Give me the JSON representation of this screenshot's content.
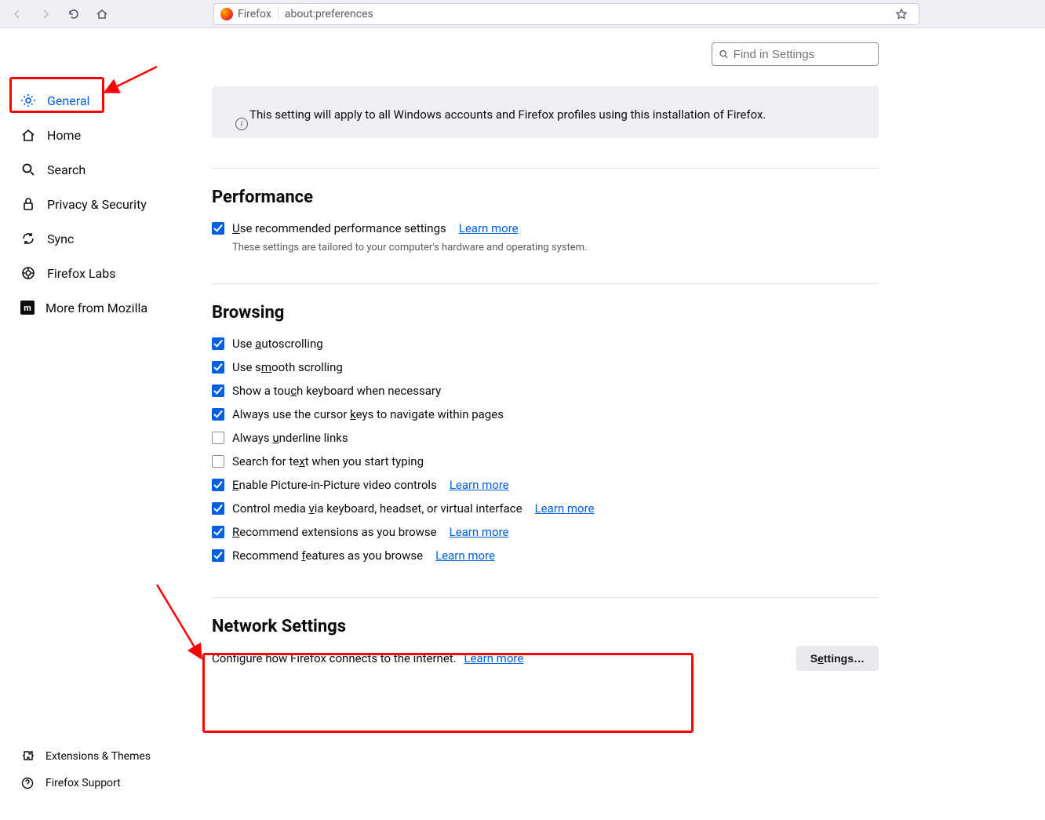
{
  "toolbar": {
    "identity_label": "Firefox",
    "url": "about:preferences"
  },
  "search": {
    "placeholder": "Find in Settings"
  },
  "sidebar": {
    "items": [
      {
        "label": "General"
      },
      {
        "label": "Home"
      },
      {
        "label": "Search"
      },
      {
        "label": "Privacy & Security"
      },
      {
        "label": "Sync"
      },
      {
        "label": "Firefox Labs"
      },
      {
        "label": "More from Mozilla"
      }
    ],
    "bottom": [
      {
        "label": "Extensions & Themes"
      },
      {
        "label": "Firefox Support"
      }
    ]
  },
  "infobox": {
    "text": "This setting will apply to all Windows accounts and Firefox profiles using this installation of Firefox."
  },
  "performance": {
    "title": "Performance",
    "option_pre": "U",
    "option_post": "se recommended performance settings",
    "learn": "Learn more",
    "subtext": "These settings are tailored to your computer's hardware and operating system."
  },
  "browsing": {
    "title": "Browsing",
    "items": [
      {
        "pre": "Use ",
        "u": "a",
        "post": "utoscrolling",
        "checked": true
      },
      {
        "pre": "Use s",
        "u": "m",
        "post": "ooth scrolling",
        "checked": true
      },
      {
        "pre": "Show a tou",
        "u": "c",
        "post": "h keyboard when necessary",
        "checked": true
      },
      {
        "pre": "Always use the cursor ",
        "u": "k",
        "post": "eys to navigate within pages",
        "checked": true
      },
      {
        "pre": "Always ",
        "u": "u",
        "post": "nderline links",
        "checked": false
      },
      {
        "pre": "Search for te",
        "u": "x",
        "post": "t when you start typing",
        "checked": false
      },
      {
        "pre": "",
        "u": "E",
        "post": "nable Picture-in-Picture video controls",
        "checked": true,
        "learn": "Learn more"
      },
      {
        "pre": "Control media ",
        "u": "v",
        "post": "ia keyboard, headset, or virtual interface",
        "checked": true,
        "learn": "Learn more"
      },
      {
        "pre": "",
        "u": "R",
        "post": "ecommend extensions as you browse",
        "checked": true,
        "learn": "Learn more"
      },
      {
        "pre": "Recommend ",
        "u": "f",
        "post": "eatures as you browse",
        "checked": true,
        "learn": "Learn more"
      }
    ]
  },
  "network": {
    "title": "Network Settings",
    "desc": "Configure how Firefox connects to the internet.",
    "learn": "Learn more",
    "button_pre": "S",
    "button_u": "e",
    "button_post": "ttings…"
  }
}
